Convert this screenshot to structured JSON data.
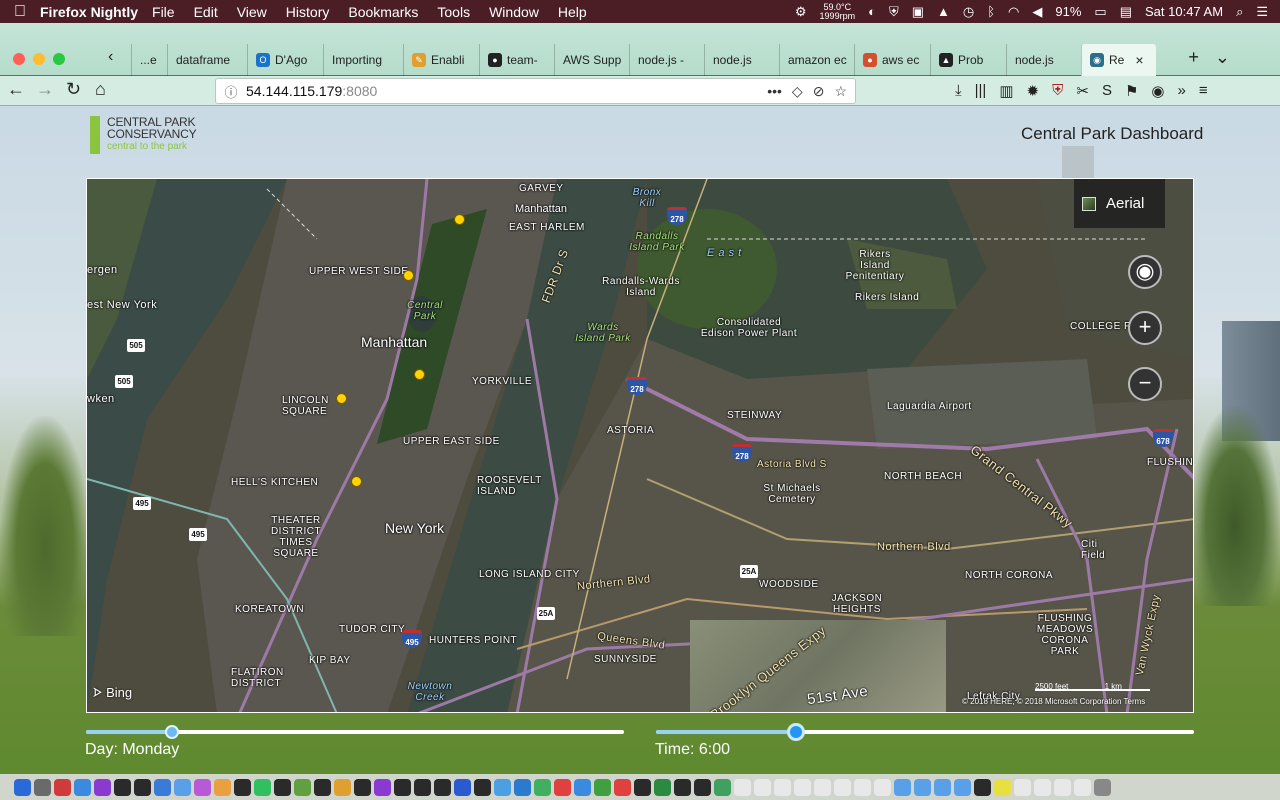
{
  "menubar": {
    "app_name": "Firefox Nightly",
    "menus": [
      "File",
      "Edit",
      "View",
      "History",
      "Bookmarks",
      "Tools",
      "Window",
      "Help"
    ],
    "temperature": "59.0°C",
    "fan_rpm": "1999rpm",
    "battery": "91%",
    "clock": "Sat 10:47 AM"
  },
  "browser": {
    "tabs": [
      {
        "label": "...e",
        "color": "#888",
        "glyph": ""
      },
      {
        "label": "dataframe",
        "color": "#888",
        "glyph": ""
      },
      {
        "label": "D'Ago",
        "color": "#1a73c8",
        "glyph": "O"
      },
      {
        "label": "Importing",
        "color": "#888",
        "glyph": ""
      },
      {
        "label": "Enabli",
        "color": "#e0a030",
        "glyph": "✎"
      },
      {
        "label": "team-",
        "color": "#222",
        "glyph": "●"
      },
      {
        "label": "AWS Supp",
        "color": "#888",
        "glyph": ""
      },
      {
        "label": "node.js -",
        "color": "#888",
        "glyph": ""
      },
      {
        "label": "node.js",
        "color": "#888",
        "glyph": ""
      },
      {
        "label": "amazon ec",
        "color": "#888",
        "glyph": ""
      },
      {
        "label": "aws ec",
        "color": "#d3502e",
        "glyph": "●"
      },
      {
        "label": "Prob",
        "color": "#222",
        "glyph": "▲"
      },
      {
        "label": "node.js",
        "color": "#888",
        "glyph": ""
      },
      {
        "label": "Re",
        "color": "#2d6e8a",
        "glyph": "◉",
        "active": true
      }
    ],
    "url_host": "54.144.115.179",
    "url_port": ":8080"
  },
  "page": {
    "logo_line1": "CENTRAL PARK",
    "logo_line2": "CONSERVANCY",
    "logo_tagline": "central to the park",
    "title": "Central Park Dashboard"
  },
  "map": {
    "style_button": "Aerial",
    "attribution": "Bing",
    "copyright": "© 2018 HERE, © 2018 Microsoft Corporation  Terms",
    "scale_ft": "2500 feet",
    "scale_km": "1 km",
    "labels": {
      "manhattan": "Manhattan",
      "new_york": "New York",
      "central_park": "Central Park",
      "upper_west_side": "UPPER WEST SIDE",
      "lincoln_square": "LINCOLN SQUARE",
      "hells_kitchen": "HELL'S KITCHEN",
      "theater_district": "THEATER DISTRICT TIMES SQUARE",
      "koreatown": "KOREATOWN",
      "kip_bay": "KIP BAY",
      "flatiron": "FLATIRON DISTRICT",
      "tudor_city": "TUDOR CITY",
      "yorkville": "YORKVILLE",
      "upper_east_side": "UPPER EAST SIDE",
      "roosevelt_island": "ROOSEVELT ISLAND",
      "east_harlem": "EAST HARLEM",
      "garvey": "GARVEY",
      "randalls_wards": "Randalls-Wards Island",
      "wards_park": "Wards Island Park",
      "randalls_park": "Randalls Island Park",
      "bronx_kill": "Bronx Kill",
      "rikers": "Rikers Island",
      "rikers_pen": "Rikers Island Penitentiary",
      "consolidated_edison": "Consolidated Edison Power Plant",
      "laguardia": "Laguardia Airport",
      "astoria": "ASTORIA",
      "steinway": "STEINWAY",
      "north_beach": "NORTH BEACH",
      "st_michaels": "St Michaels Cemetery",
      "woodside": "WOODSIDE",
      "jackson_heights": "JACKSON HEIGHTS",
      "north_corona": "NORTH CORONA",
      "flushing_meadows": "FLUSHING MEADOWS CORONA PARK",
      "long_island_city": "LONG ISLAND CITY",
      "hunters_point": "HUNTERS POINT",
      "sunnyside": "SUNNYSIDE",
      "newtown_creek": "Newtown Creek",
      "college_point": "COLLEGE POINT",
      "flushing": "FLUSHING",
      "citi_field": "Citi Field",
      "grand_central": "Grand Central Pkwy",
      "northern_blvd": "Northern Blvd",
      "astoria_blvd": "Astoria Blvd S",
      "fdr": "FDR Dr S",
      "east_river": "E a s t",
      "new_york_st": "est New York",
      "bergen": "ergen",
      "hoboken": "wken",
      "lefrak": "Lefrak City",
      "queens_blvd": "Queens Blvd",
      "van_wyck": "Van Wyck Expy",
      "brooklyn_queens": "Brooklyn Queens Expy",
      "ave51": "51st Ave"
    }
  },
  "controls": {
    "day_label": "Day: Monday",
    "time_label": "Time: 6:00",
    "day_value": 0.16,
    "time_value": 0.26
  }
}
